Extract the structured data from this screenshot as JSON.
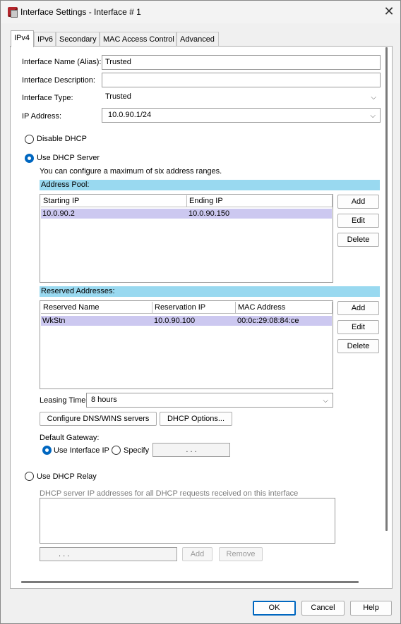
{
  "window": {
    "title": "Interface Settings - Interface # 1"
  },
  "tabs": [
    {
      "label": "IPv4"
    },
    {
      "label": "IPv6"
    },
    {
      "label": "Secondary"
    },
    {
      "label": "MAC Access Control"
    },
    {
      "label": "Advanced"
    }
  ],
  "form": {
    "name_label": "Interface Name (Alias):",
    "name_value": "Trusted",
    "desc_label": "Interface Description:",
    "desc_value": "",
    "type_label": "Interface Type:",
    "type_value": "Trusted",
    "ip_label": "IP Address:",
    "ip_value": "10.0.90.1/24"
  },
  "dhcp": {
    "disable_label": "Disable DHCP",
    "server_label": "Use DHCP Server",
    "server_note": "You can configure a maximum of six address ranges.",
    "selected_mode": "Use DHCP Server",
    "pool": {
      "title": "Address Pool:",
      "columns": [
        "Starting IP",
        "Ending IP"
      ],
      "rows": [
        {
          "start": "10.0.90.2",
          "end": "10.0.90.150"
        }
      ],
      "add_label": "Add",
      "edit_label": "Edit",
      "delete_label": "Delete"
    },
    "reserved": {
      "title": "Reserved Addresses:",
      "columns": [
        "Reserved Name",
        "Reservation IP",
        "MAC Address"
      ],
      "rows": [
        {
          "name": "WkStn",
          "ip": "10.0.90.100",
          "mac": "00:0c:29:08:84:ce"
        }
      ],
      "add_label": "Add",
      "edit_label": "Edit",
      "delete_label": "Delete"
    },
    "leasing_label": "Leasing Time",
    "leasing_value": "8 hours",
    "configure_dns_label": "Configure DNS/WINS servers",
    "dhcp_options_label": "DHCP Options...",
    "gateway": {
      "label": "Default Gateway:",
      "use_interface_label": "Use Interface IP",
      "specify_label": "Specify",
      "selected": "Use Interface IP",
      "ip_placeholder": ".   .   ."
    },
    "relay": {
      "label": "Use DHCP Relay",
      "note": "DHCP server IP addresses for all DHCP requests received on this interface",
      "ip_placeholder": ".   .   .",
      "add_label": "Add",
      "remove_label": "Remove"
    }
  },
  "footer": {
    "ok_label": "OK",
    "cancel_label": "Cancel",
    "help_label": "Help"
  },
  "colors": {
    "accent": "#0067c0",
    "section_bar": "#99d9f0",
    "selected_row": "#ccc8f0"
  },
  "icons": {
    "app": "app-icon",
    "close": "close-icon",
    "dropdown": "chevron-down-icon"
  }
}
